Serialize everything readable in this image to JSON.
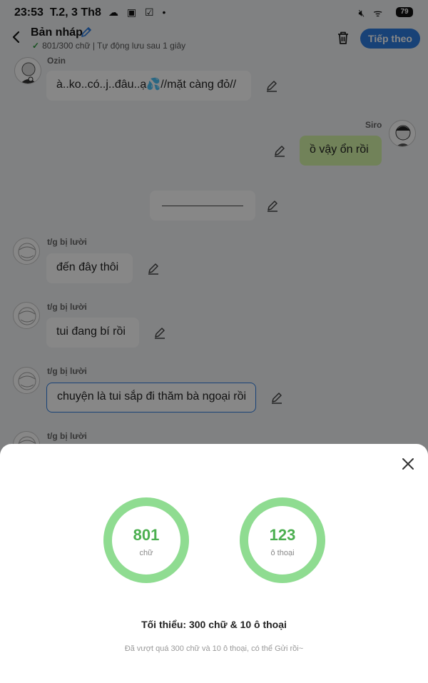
{
  "status_bar": {
    "time": "23:53",
    "date": "T.2, 3 Th8",
    "battery": "79"
  },
  "header": {
    "title": "Bản nháp",
    "subtitle": "801/300 chữ | Tự động lưu sau 1 giây",
    "next_label": "Tiếp theo"
  },
  "messages": [
    {
      "sender": "Ozin",
      "text": "à..ko..có..j..đâu..ạ💦//mặt càng đỏ//",
      "side": "left"
    },
    {
      "sender": "Siro",
      "text": "ồ vậy ổn rồi",
      "side": "right"
    },
    {
      "sender": "",
      "text": "",
      "side": "center"
    },
    {
      "sender": "t/g bị lười",
      "text": "đến đây thôi",
      "side": "left"
    },
    {
      "sender": "t/g bị lười",
      "text": "tui đang bí rồi",
      "side": "left"
    },
    {
      "sender": "t/g bị lười",
      "text": "chuyện là tui sắp đi thăm bà ngoại rồi",
      "side": "left"
    },
    {
      "sender": "t/g bị lười",
      "text": "",
      "side": "left"
    }
  ],
  "sheet": {
    "words_count": "801",
    "words_label": "chữ",
    "dialogs_count": "123",
    "dialogs_label": "ô thoại",
    "minimum_text": "Tối thiểu: 300 chữ & 10 ô thoại",
    "note_text": "Đã vượt quá 300 chữ và 10 ô thoại, có thể Gửi rồi~"
  },
  "colors": {
    "accent_blue": "#2f7de1",
    "ring_green": "#8fdc91",
    "count_green": "#4caf50",
    "bubble_green": "#d6f5a9"
  },
  "icons": [
    "back-icon",
    "pen-icon",
    "trash-icon",
    "edit-icon",
    "close-icon",
    "mute-icon",
    "wifi-icon"
  ]
}
